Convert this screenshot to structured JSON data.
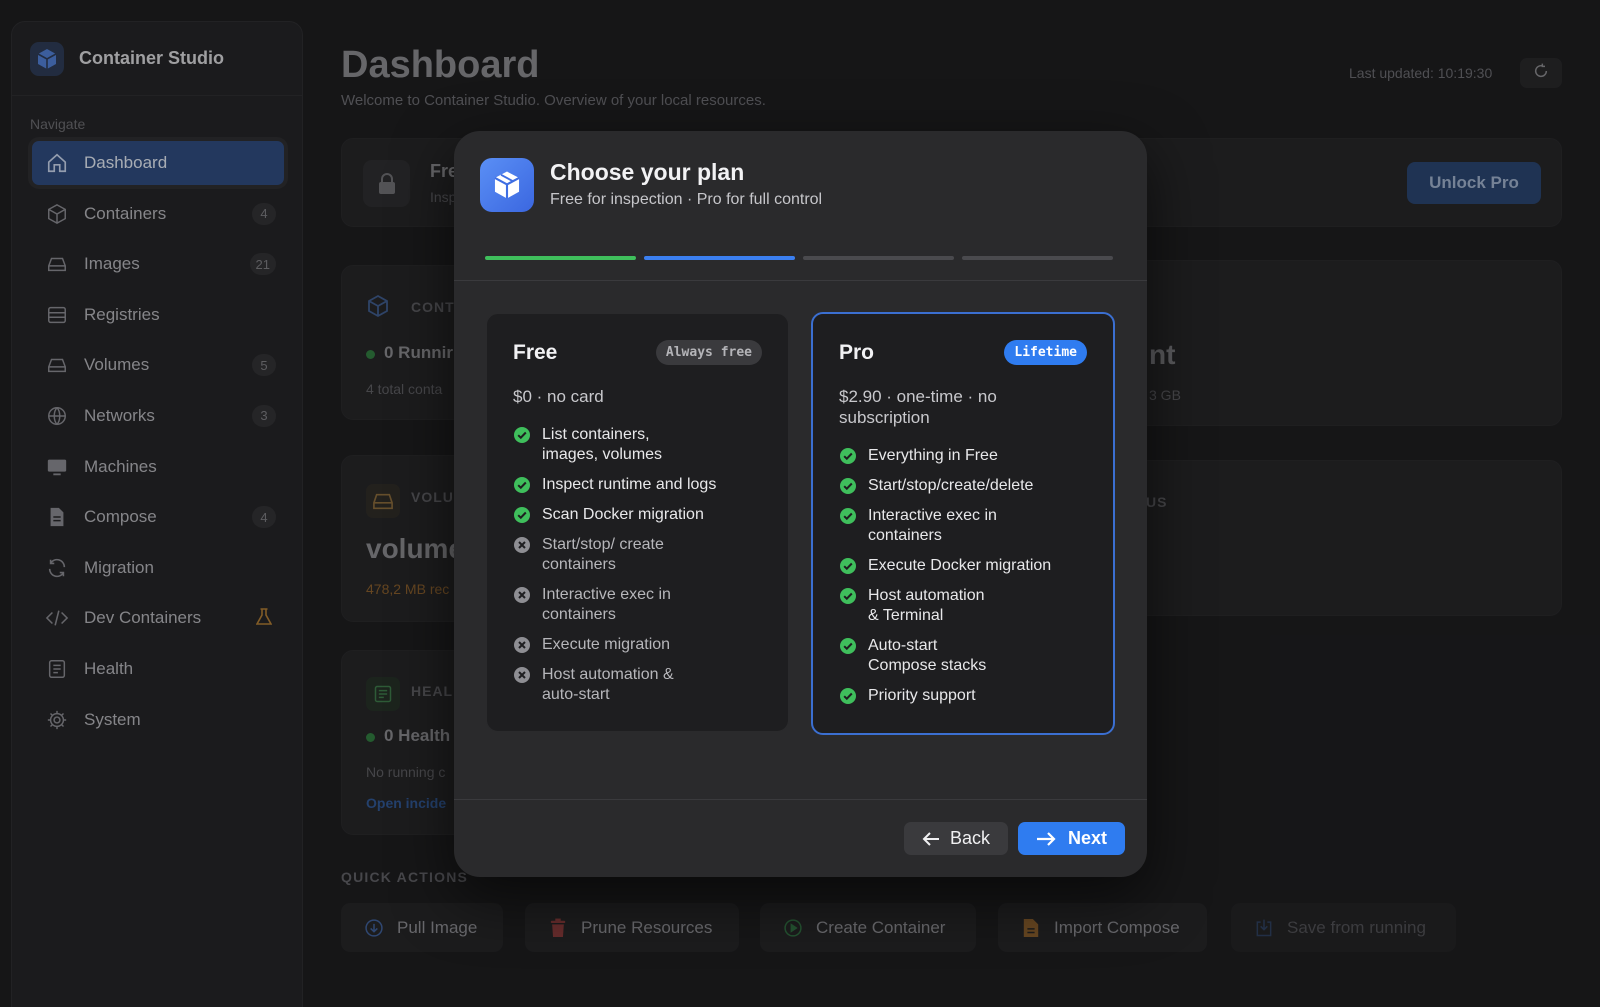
{
  "sidebar": {
    "app_name": "Container Studio",
    "nav_caption": "Navigate",
    "items": [
      {
        "label": "Dashboard",
        "icon": "home-icon"
      },
      {
        "label": "Containers",
        "badge": "4",
        "icon": "cube-icon"
      },
      {
        "label": "Images",
        "badge": "21",
        "icon": "drive-icon"
      },
      {
        "label": "Registries",
        "icon": "server-icon"
      },
      {
        "label": "Volumes",
        "badge": "5",
        "icon": "drive-icon"
      },
      {
        "label": "Networks",
        "badge": "3",
        "icon": "globe-icon"
      },
      {
        "label": "Machines",
        "icon": "monitor-icon"
      },
      {
        "label": "Compose",
        "badge": "4",
        "icon": "file-icon"
      },
      {
        "label": "Migration",
        "icon": "sync-icon"
      },
      {
        "label": "Dev Containers",
        "icon": "code-icon"
      },
      {
        "label": "Health",
        "icon": "health-icon"
      },
      {
        "label": "System",
        "icon": "gear-icon"
      }
    ]
  },
  "header": {
    "title": "Dashboard",
    "subtitle": "Welcome to Container Studio. Overview of your local resources.",
    "last_updated": "Last updated: 10:19:30"
  },
  "background": {
    "banner_title_fragment": "Fre",
    "banner_sub_fragment": "Insp",
    "unlock_label": "Unlock Pro",
    "containers_caption_fragment": "CONT",
    "running_fragment": "0 Runnir",
    "total_fragment": "4 total conta",
    "right_card_fragment": "nt",
    "right_card_sub_fragment": "3 GB",
    "volumes_caption_fragment": "VOLU",
    "volumes_value_fragment": "volume",
    "volumes_sub_fragment": "478,2 MB rec",
    "status_fragment": "US",
    "health_caption_fragment": "HEAL",
    "healthy_fragment": "0 Health",
    "no_running_fragment": "No running c",
    "open_fragment": "Open incide"
  },
  "quick_actions": {
    "title": "QUICK ACTIONS",
    "buttons": [
      {
        "label": "Pull Image"
      },
      {
        "label": "Prune Resources"
      },
      {
        "label": "Create Container"
      },
      {
        "label": "Import Compose"
      },
      {
        "label": "Save from running"
      }
    ]
  },
  "modal": {
    "title": "Choose your plan",
    "subtitle": "Free for inspection · Pro for full control",
    "steps_total": 4,
    "steps_completed": 1,
    "current_step": 2,
    "plans": {
      "free": {
        "name": "Free",
        "badge": "Always free",
        "price": "$0 · no card",
        "features": [
          {
            "text": "List containers, images, volumes",
            "included": true
          },
          {
            "text": "Inspect runtime and logs",
            "included": true
          },
          {
            "text": "Scan Docker migration",
            "included": true
          },
          {
            "text": "Start/stop/ create containers",
            "included": false
          },
          {
            "text": "Interactive exec in containers",
            "included": false
          },
          {
            "text": "Execute migration",
            "included": false
          },
          {
            "text": "Host automation & auto-start",
            "included": false
          }
        ]
      },
      "pro": {
        "name": "Pro",
        "badge": "Lifetime",
        "price": "$2.90 · one-time · no subscription",
        "features": [
          {
            "text": "Everything in Free",
            "included": true
          },
          {
            "text": "Start/stop/create/delete",
            "included": true
          },
          {
            "text": "Interactive exec in containers",
            "included": true
          },
          {
            "text": "Execute Docker migration",
            "included": true
          },
          {
            "text": "Host automation & Terminal",
            "included": true
          },
          {
            "text": "Auto-start Compose stacks",
            "included": true
          },
          {
            "text": "Priority support",
            "included": true
          }
        ]
      }
    },
    "back_label": "Back",
    "next_label": "Next"
  },
  "colors": {
    "accent": "#2f7cf0",
    "success": "#3fbf5c",
    "sidebar_active": "#2d4a7e"
  }
}
